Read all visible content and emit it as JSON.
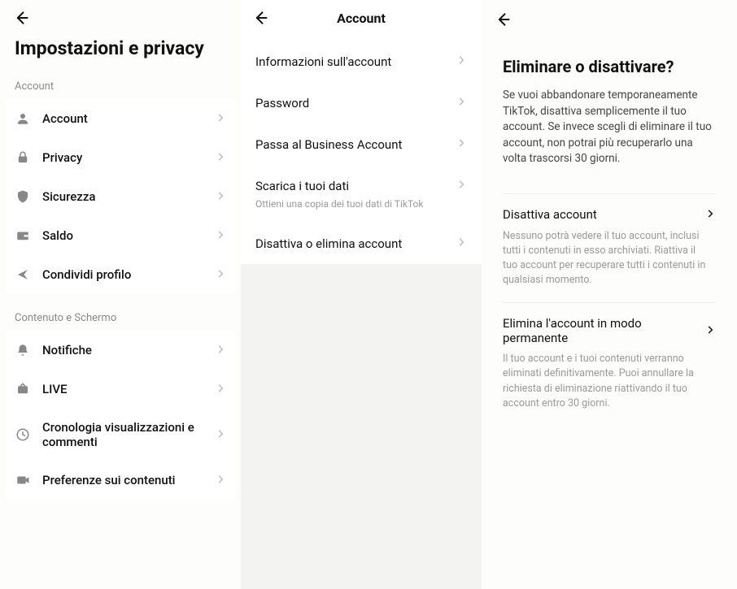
{
  "pane1": {
    "title": "Impostazioni e privacy",
    "section1_label": "Account",
    "section2_label": "Contenuto e Schermo",
    "items1": [
      {
        "label": "Account",
        "icon": "person-icon"
      },
      {
        "label": "Privacy",
        "icon": "lock-icon"
      },
      {
        "label": "Sicurezza",
        "icon": "shield-icon"
      },
      {
        "label": "Saldo",
        "icon": "wallet-icon"
      },
      {
        "label": "Condividi profilo",
        "icon": "share-icon"
      }
    ],
    "items2": [
      {
        "label": "Notifiche",
        "icon": "bell-icon"
      },
      {
        "label": "LIVE",
        "icon": "live-icon"
      },
      {
        "label": "Cronologia visualizzazioni e commenti",
        "icon": "history-icon"
      },
      {
        "label": "Preferenze sui contenuti",
        "icon": "video-icon"
      }
    ]
  },
  "pane2": {
    "title": "Account",
    "items": [
      {
        "label": "Informazioni sull'account",
        "sub": ""
      },
      {
        "label": "Password",
        "sub": ""
      },
      {
        "label": "Passa al Business Account",
        "sub": ""
      },
      {
        "label": "Scarica i tuoi dati",
        "sub": "Ottieni una copia dei tuoi dati di TikTok"
      },
      {
        "label": "Disattiva o elimina account",
        "sub": ""
      }
    ]
  },
  "pane3": {
    "title": "Eliminare o disattivare?",
    "desc": "Se vuoi abbandonare temporaneamente TikTok, disattiva semplicemente il tuo account. Se invece scegli di eliminare il tuo account, non potrai più recuperarlo una volta trascorsi 30 giorni.",
    "options": [
      {
        "label": "Disattiva account",
        "sub": "Nessuno potrà vedere il tuo account, inclusi tutti i contenuti in esso archiviati. Riattiva il tuo account per recuperare tutti i contenuti in qualsiasi momento."
      },
      {
        "label": "Elimina l'account in modo permanente",
        "sub": "Il tuo account e i tuoi contenuti verranno eliminati definitivamente. Puoi annullare la richiesta di eliminazione riattivando il tuo account entro 30 giorni."
      }
    ]
  }
}
